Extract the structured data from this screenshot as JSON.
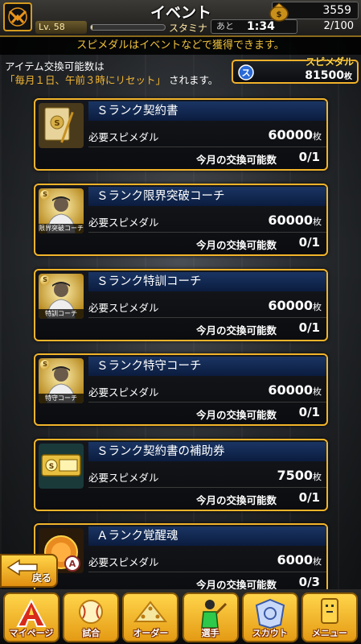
{
  "header": {
    "title": "イベント",
    "level": "Lv. 58",
    "stamina_label": "スタミナ",
    "stamina_fraction": 0.02,
    "timer_prefix": "あと",
    "timer": "1:34",
    "stamina_count": "2/100",
    "coins": "3559"
  },
  "notice": "スピメダルはイベントなどで獲得できます。",
  "info": {
    "line1": "アイテム交換可能数は",
    "line2_reset": "「毎月１日、午前３時にリセット」",
    "line2_tail": "されます。"
  },
  "balance": {
    "label": "スピメダル",
    "value": "81500",
    "unit": "枚"
  },
  "cards": [
    {
      "title": "Ｓランク契約書",
      "cost_label": "必要スピメダル",
      "cost": "60000",
      "unit": "枚",
      "limit_label": "今月の交換可能数",
      "limit": "0/1",
      "icon": "contract-icon",
      "caption": ""
    },
    {
      "title": "Ｓランク限界突破コーチ",
      "cost_label": "必要スピメダル",
      "cost": "60000",
      "unit": "枚",
      "limit_label": "今月の交換可能数",
      "limit": "0/1",
      "icon": "coach-icon",
      "caption": "限界突破コーチ"
    },
    {
      "title": "Ｓランク特訓コーチ",
      "cost_label": "必要スピメダル",
      "cost": "60000",
      "unit": "枚",
      "limit_label": "今月の交換可能数",
      "limit": "0/1",
      "icon": "coach-icon",
      "caption": "特訓コーチ"
    },
    {
      "title": "Ｓランク特守コーチ",
      "cost_label": "必要スピメダル",
      "cost": "60000",
      "unit": "枚",
      "limit_label": "今月の交換可能数",
      "limit": "0/1",
      "icon": "coach-icon",
      "caption": "特守コーチ"
    },
    {
      "title": "Ｓランク契約書の補助券",
      "cost_label": "必要スピメダル",
      "cost": "7500",
      "unit": "枚",
      "limit_label": "今月の交換可能数",
      "limit": "0/1",
      "icon": "ticket-icon",
      "caption": ""
    },
    {
      "title": "Ａランク覚醒魂",
      "cost_label": "必要スピメダル",
      "cost": "6000",
      "unit": "枚",
      "limit_label": "今月の交換可能数",
      "limit": "0/3",
      "icon": "soul-icon",
      "caption": ""
    }
  ],
  "back_label": "戻る",
  "nav": [
    {
      "label": "マイページ",
      "icon": "mypage-icon"
    },
    {
      "label": "試合",
      "icon": "baseball-icon"
    },
    {
      "label": "オーダー",
      "icon": "order-icon"
    },
    {
      "label": "選手",
      "icon": "player-icon"
    },
    {
      "label": "スカウト",
      "icon": "scout-icon"
    },
    {
      "label": "メニュー",
      "icon": "menu-icon"
    }
  ],
  "colors": {
    "accent": "#f2b42a",
    "title_bar": "#1a3563",
    "notice_text": "#f0c23c"
  }
}
